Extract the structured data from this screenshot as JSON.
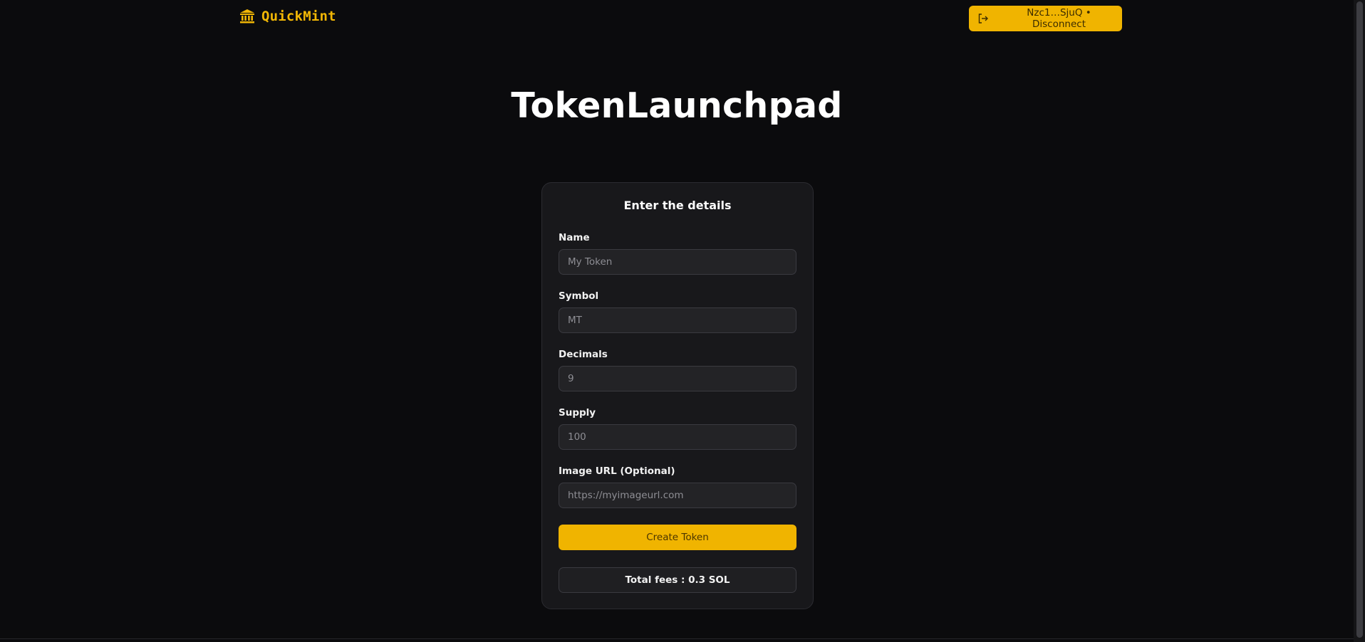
{
  "header": {
    "brand_name": "QuickMint",
    "brand_icon": "bank-icon",
    "wallet_button_label": "Nzc1…SjuQ • Disconnect",
    "wallet_button_icon": "logout-icon"
  },
  "main": {
    "title": "TokenLaunchpad"
  },
  "form": {
    "title": "Enter the details",
    "fields": [
      {
        "label": "Name",
        "placeholder": "My Token",
        "value": ""
      },
      {
        "label": "Symbol",
        "placeholder": "MT",
        "value": ""
      },
      {
        "label": "Decimals",
        "placeholder": "9",
        "value": ""
      },
      {
        "label": "Supply",
        "placeholder": "100",
        "value": ""
      },
      {
        "label": "Image URL (Optional)",
        "placeholder": "https://myimageurl.com",
        "value": ""
      }
    ],
    "submit_label": "Create Token",
    "fees_text": "Total fees : 0.3 SOL"
  },
  "colors": {
    "background": "#0b0b0d",
    "card": "#18181b",
    "accent": "#f0b400",
    "brand": "#f2b705",
    "input_bg": "#232326",
    "input_border": "#3a3a40"
  }
}
